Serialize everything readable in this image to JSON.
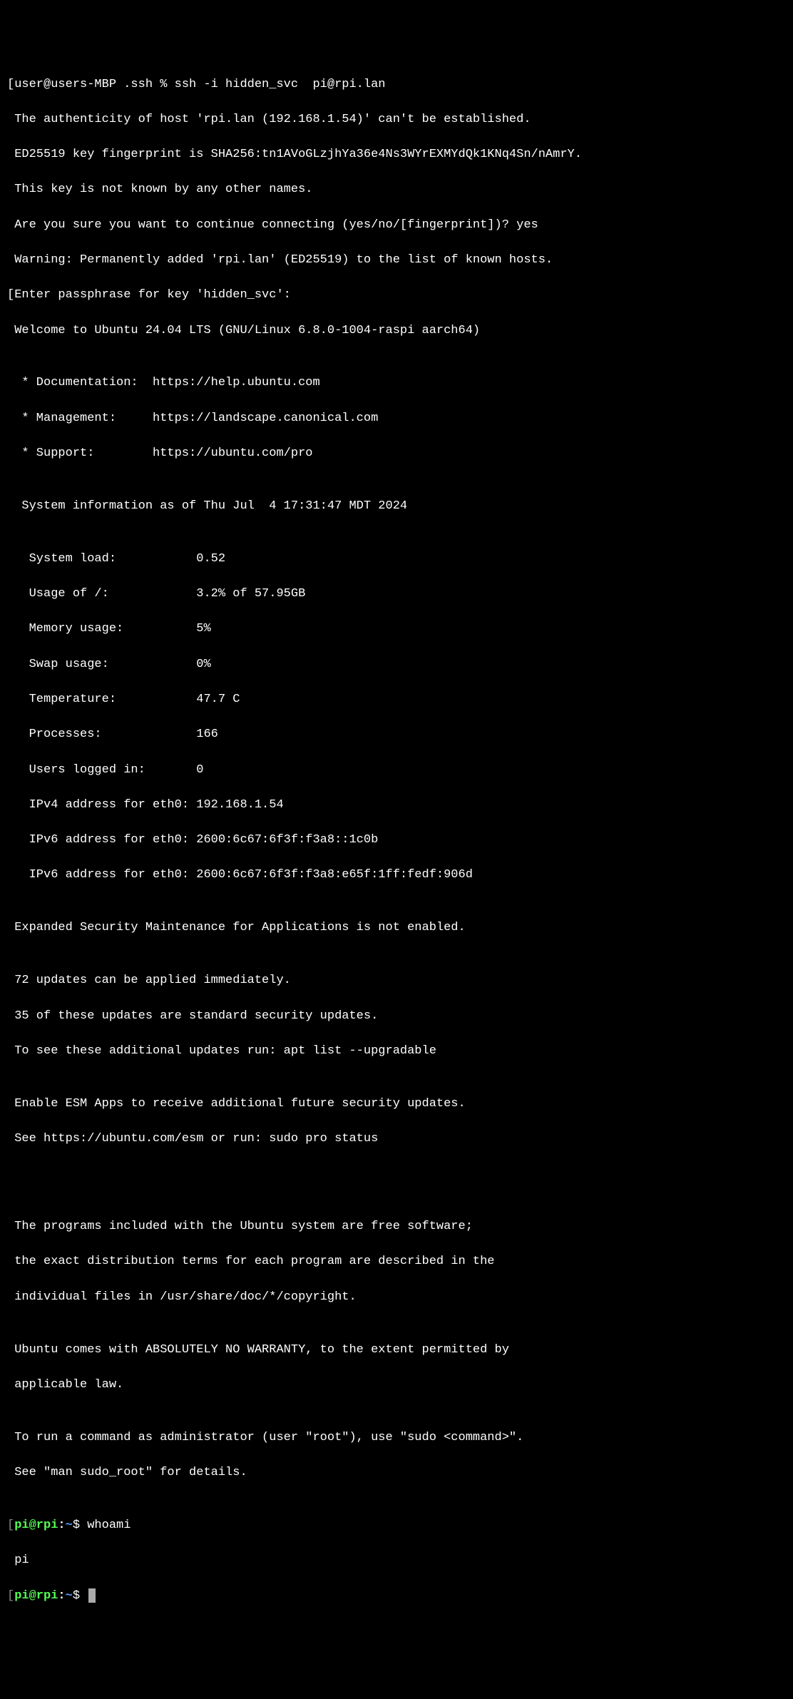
{
  "lines": {
    "l0": "[user@users-MBP .ssh % ssh -i hidden_svc  pi@rpi.lan",
    "l1": " The authenticity of host 'rpi.lan (192.168.1.54)' can't be established.",
    "l2": " ED25519 key fingerprint is SHA256:tn1AVoGLzjhYa36e4Ns3WYrEXMYdQk1KNq4Sn/nAmrY.",
    "l3": " This key is not known by any other names.",
    "l4": " Are you sure you want to continue connecting (yes/no/[fingerprint])? yes",
    "l5": " Warning: Permanently added 'rpi.lan' (ED25519) to the list of known hosts.",
    "l6": "[Enter passphrase for key 'hidden_svc':",
    "l7": " Welcome to Ubuntu 24.04 LTS (GNU/Linux 6.8.0-1004-raspi aarch64)",
    "l8": "",
    "l9": "  * Documentation:  https://help.ubuntu.com",
    "l10": "  * Management:     https://landscape.canonical.com",
    "l11": "  * Support:        https://ubuntu.com/pro",
    "l12": "",
    "l13": "  System information as of Thu Jul  4 17:31:47 MDT 2024",
    "l14": "",
    "l15": "   System load:           0.52",
    "l16": "   Usage of /:            3.2% of 57.95GB",
    "l17": "   Memory usage:          5%",
    "l18": "   Swap usage:            0%",
    "l19": "   Temperature:           47.7 C",
    "l20": "   Processes:             166",
    "l21": "   Users logged in:       0",
    "l22": "   IPv4 address for eth0: 192.168.1.54",
    "l23": "   IPv6 address for eth0: 2600:6c67:6f3f:f3a8::1c0b",
    "l24": "   IPv6 address for eth0: 2600:6c67:6f3f:f3a8:e65f:1ff:fedf:906d",
    "l25": "",
    "l26": " Expanded Security Maintenance for Applications is not enabled.",
    "l27": "",
    "l28": " 72 updates can be applied immediately.",
    "l29": " 35 of these updates are standard security updates.",
    "l30": " To see these additional updates run: apt list --upgradable",
    "l31": "",
    "l32": " Enable ESM Apps to receive additional future security updates.",
    "l33": " See https://ubuntu.com/esm or run: sudo pro status",
    "l34": "",
    "l35": "",
    "l36": "",
    "l37": " The programs included with the Ubuntu system are free software;",
    "l38": " the exact distribution terms for each program are described in the",
    "l39": " individual files in /usr/share/doc/*/copyright.",
    "l40": "",
    "l41": " Ubuntu comes with ABSOLUTELY NO WARRANTY, to the extent permitted by",
    "l42": " applicable law.",
    "l43": "",
    "l44": " To run a command as administrator (user \"root\"), use \"sudo <command>\".",
    "l45": " See \"man sudo_root\" for details.",
    "l46": ""
  },
  "prompt1": {
    "bracket_open": "[",
    "user_host": "pi@rpi",
    "colon": ":",
    "tilde": "~",
    "dollar": "$",
    "command": " whoami"
  },
  "whoami_output": " pi",
  "prompt2": {
    "bracket_open": "[",
    "user_host": "pi@rpi",
    "colon": ":",
    "tilde": "~",
    "dollar": "$",
    "command": " "
  }
}
